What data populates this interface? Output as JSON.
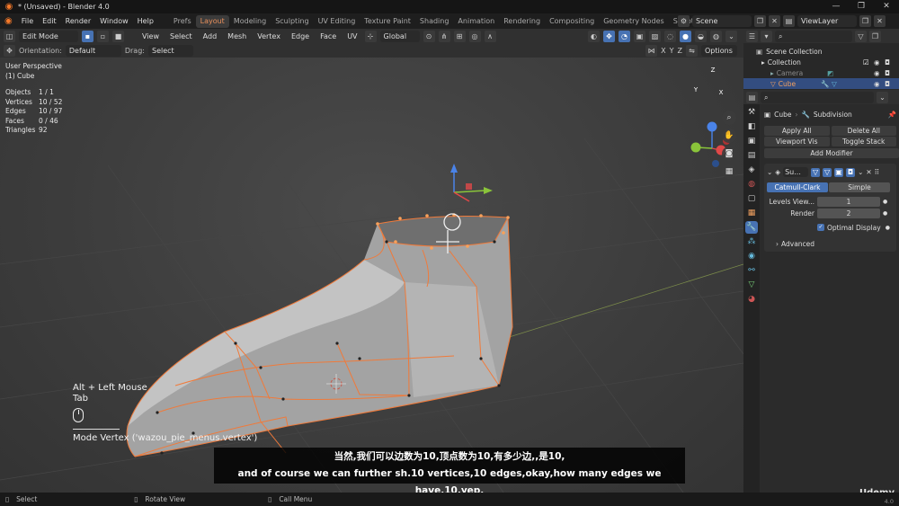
{
  "window": {
    "title": "* (Unsaved) - Blender 4.0",
    "min": "—",
    "max": "❐",
    "close": "✕"
  },
  "menu": [
    "File",
    "Edit",
    "Render",
    "Window",
    "Help"
  ],
  "workspaces": [
    "Prefs",
    "Layout",
    "Modeling",
    "Sculpting",
    "UV Editing",
    "Texture Paint",
    "Shading",
    "Animation",
    "Rendering",
    "Compositing",
    "Geometry Nodes",
    "Scripting"
  ],
  "active_workspace": "Layout",
  "add_workspace": "+",
  "scene": {
    "label": "Scene",
    "view_layer": "ViewLayer"
  },
  "vp_header": {
    "mode": "Edit Mode",
    "menus": [
      "View",
      "Select",
      "Add",
      "Mesh",
      "Vertex",
      "Edge",
      "Face",
      "UV"
    ],
    "transform": "Global",
    "options": "Options"
  },
  "vp_header2": {
    "orientation_label": "Orientation:",
    "orientation_value": "Default",
    "drag_label": "Drag:",
    "drag_value": "Select Box",
    "axes": [
      "X",
      "Y",
      "Z"
    ]
  },
  "viewport_info": {
    "perspective": "User Perspective",
    "object": "(1) Cube",
    "stats": [
      {
        "label": "Objects",
        "value": "1 / 1"
      },
      {
        "label": "Vertices",
        "value": "10 / 52"
      },
      {
        "label": "Edges",
        "value": "10 / 97"
      },
      {
        "label": "Faces",
        "value": "0 / 46"
      },
      {
        "label": "Triangles",
        "value": "92"
      }
    ]
  },
  "gizmo": {
    "z": "Z",
    "y": "Y",
    "x": "X"
  },
  "key_hint": {
    "combo": "Alt + Left Mouse",
    "key": "Tab",
    "operator": "Mode Vertex ('wazou_pie_menus.vertex')"
  },
  "subtitles": {
    "cn": "当然,我们可以边数为10,顶点数为10,有多少边,,是10,",
    "en": "and of course we can further sh.10 vertices,10 edges,okay,how many edges we have,10,yep,"
  },
  "outliner": {
    "root": "Scene Collection",
    "items": [
      {
        "name": "Collection"
      },
      {
        "name": "Camera"
      },
      {
        "name": "Cube"
      }
    ]
  },
  "properties": {
    "breadcrumb_object": "Cube",
    "breadcrumb_modifier": "Subdivision",
    "apply_all": "Apply All",
    "delete_all": "Delete All",
    "viewport_vis": "Viewport Vis",
    "toggle_stack": "Toggle Stack",
    "add_modifier": "Add Modifier",
    "modifier_name": "Su...",
    "tab_catmull": "Catmull-Clark",
    "tab_simple": "Simple",
    "levels_label": "Levels View...",
    "levels_value": "1",
    "render_label": "Render",
    "render_value": "2",
    "optimal_display": "Optimal Display",
    "advanced": "Advanced"
  },
  "status": {
    "select": "Select",
    "rotate": "Rotate View",
    "menu": "Call Menu"
  },
  "watermark": "Udemy",
  "version": "4.0",
  "colors": {
    "accent": "#e8905c",
    "selection": "#4772b3",
    "edge": "#f07a3a"
  }
}
